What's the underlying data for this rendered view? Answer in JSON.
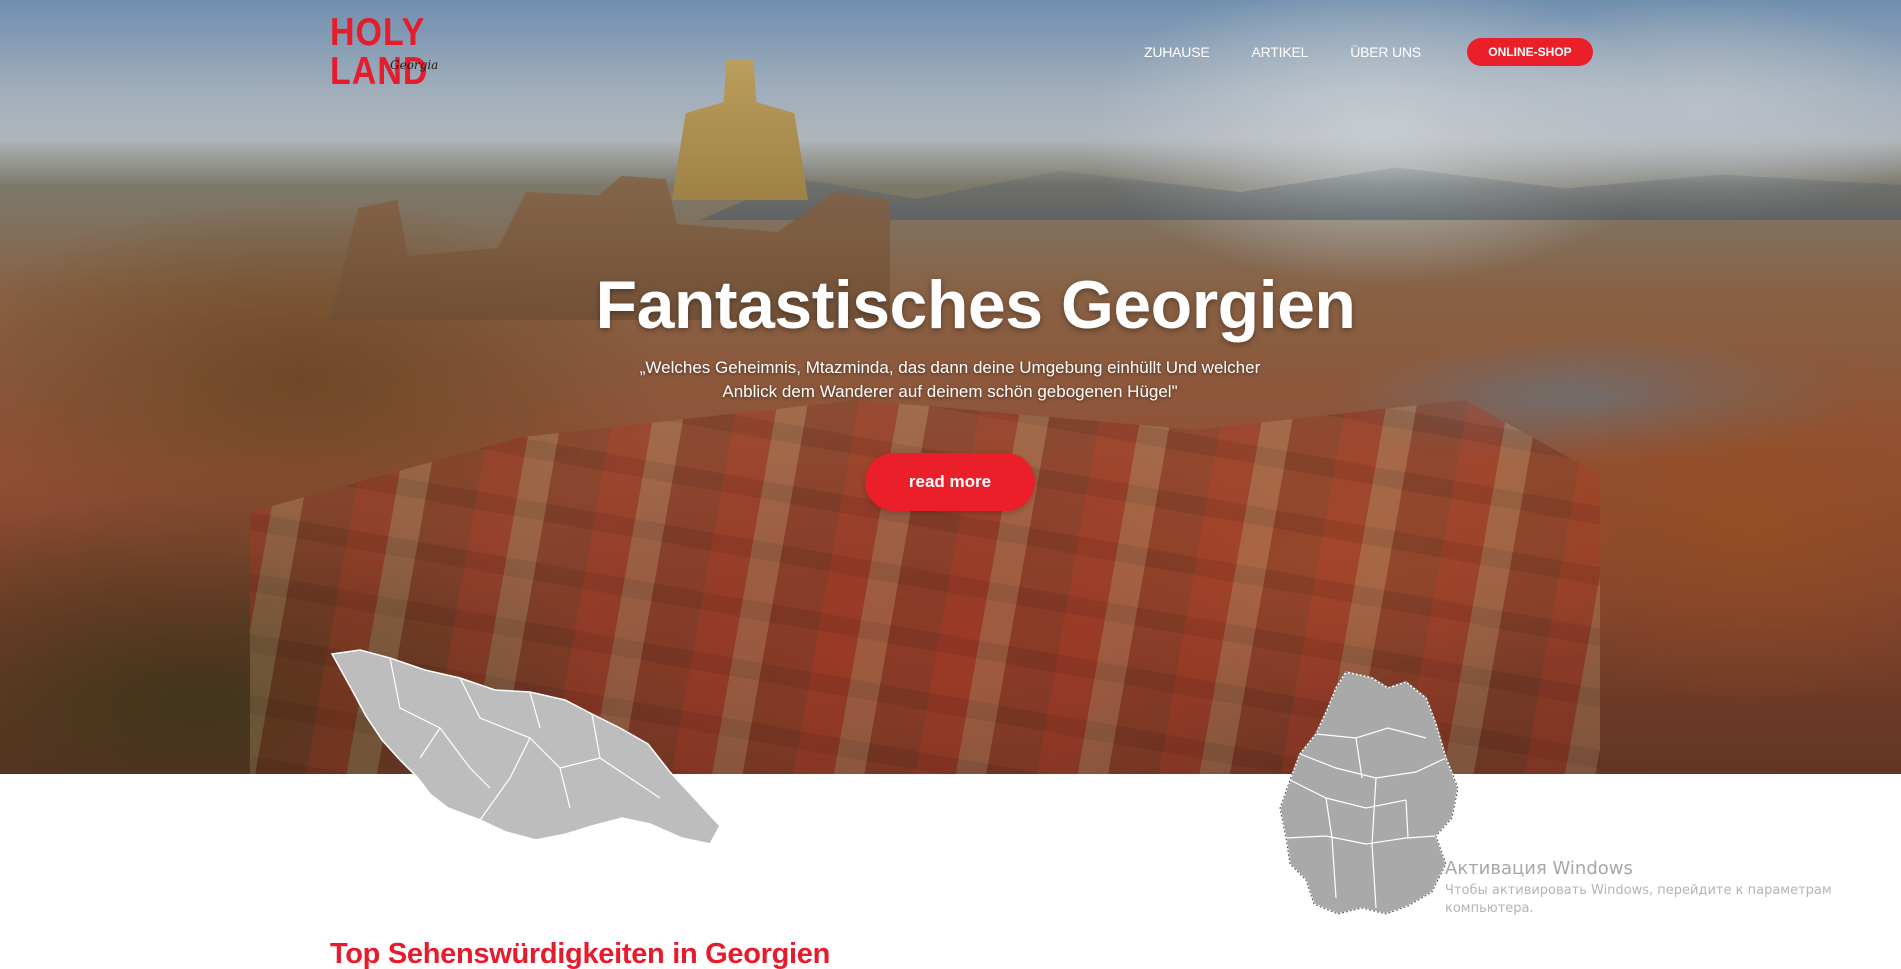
{
  "logo": {
    "title": "HOLY LAND",
    "subtitle": "Georgia"
  },
  "nav": {
    "items": [
      "ZUHAUSE",
      "ARTIKEL",
      "ÜBER UNS"
    ],
    "shop_label": "ONLINE-SHOP"
  },
  "hero": {
    "title": "Fantastisches Georgien",
    "quote": "„Welches Geheimnis, Mtazminda, das dann deine Umgebung einhüllt Und welcher Anblick dem Wanderer auf deinem schön gebogenen Hügel\"",
    "button_label": "read more"
  },
  "colors": {
    "accent": "#ea1f2a",
    "map_fill": "#bdbdbd",
    "map_stroke": "#ffffff"
  },
  "watermark": {
    "title": "Активация Windows",
    "subtitle": "Чтобы активировать Windows, перейдите к параметрам компьютера."
  },
  "section": {
    "title": "Top Sehenswürdigkeiten in Georgien"
  }
}
